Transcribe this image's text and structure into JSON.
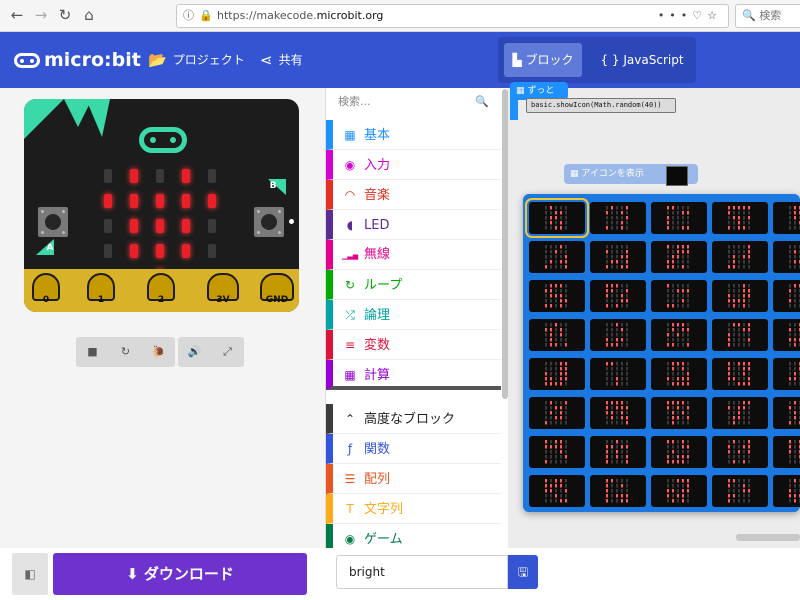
{
  "browser": {
    "url_prefix": "https://makecode.",
    "url_domain": "microbit.org",
    "search_placeholder": "検索"
  },
  "app": {
    "logo": "micro:bit",
    "projects_label": "プロジェクト",
    "share_label": "共有",
    "blocks_tab": "ブロック",
    "js_tab": "JavaScript",
    "colors": {
      "header": "#3454d1",
      "download": "#6e33cc",
      "accent_teal": "#3bd9a8",
      "led_on": "#e8202a"
    }
  },
  "simulator": {
    "buttons": {
      "a": "A",
      "b": "B"
    },
    "pins": [
      "0",
      "1",
      "2",
      "3V",
      "GND"
    ],
    "led_matrix": [
      [
        0,
        1,
        0,
        1,
        0
      ],
      [
        1,
        1,
        1,
        1,
        1
      ],
      [
        0,
        1,
        1,
        1,
        0
      ],
      [
        0,
        1,
        1,
        1,
        0
      ],
      [
        0,
        0,
        1,
        0,
        0
      ]
    ],
    "controls": [
      "stop-icon",
      "restart-icon",
      "slow-motion-icon",
      "audio-icon",
      "fullscreen-icon"
    ]
  },
  "toolbox": {
    "search_placeholder": "検索...",
    "categories": [
      {
        "label": "基本",
        "color": "#1e90ff",
        "icon": "grid-icon"
      },
      {
        "label": "入力",
        "color": "#d400d4",
        "icon": "input-icon"
      },
      {
        "label": "音楽",
        "color": "#e63022",
        "icon": "headphones-icon"
      },
      {
        "label": "LED",
        "color": "#5c2d91",
        "icon": "toggle-icon"
      },
      {
        "label": "無線",
        "color": "#e3008c",
        "icon": "signal-icon"
      },
      {
        "label": "ループ",
        "color": "#00aa00",
        "icon": "refresh-icon"
      },
      {
        "label": "論理",
        "color": "#00a4a6",
        "icon": "shuffle-icon"
      },
      {
        "label": "変数",
        "color": "#dc143c",
        "icon": "lines-icon"
      },
      {
        "label": "計算",
        "color": "#9400d3",
        "icon": "calculator-icon"
      },
      {
        "label": "高度なブロック",
        "color": "#3c3c3c",
        "icon": "chevron-up-icon"
      },
      {
        "label": "関数",
        "color": "#3455db",
        "icon": "function-icon"
      },
      {
        "label": "配列",
        "color": "#e65722",
        "icon": "list-icon"
      },
      {
        "label": "文字列",
        "color": "#ffab19",
        "icon": "text-icon"
      },
      {
        "label": "ゲーム",
        "color": "#007a4b",
        "icon": "gamepad-icon"
      }
    ]
  },
  "workspace": {
    "forever_block": "ずっと",
    "code_tooltip": "basic.showIcon(Math.random(40))",
    "show_icon_block": "アイコンを表示",
    "icon_count": 40,
    "selected_icon_index": 0
  },
  "footer": {
    "download_label": "ダウンロード",
    "project_name": "bright"
  }
}
